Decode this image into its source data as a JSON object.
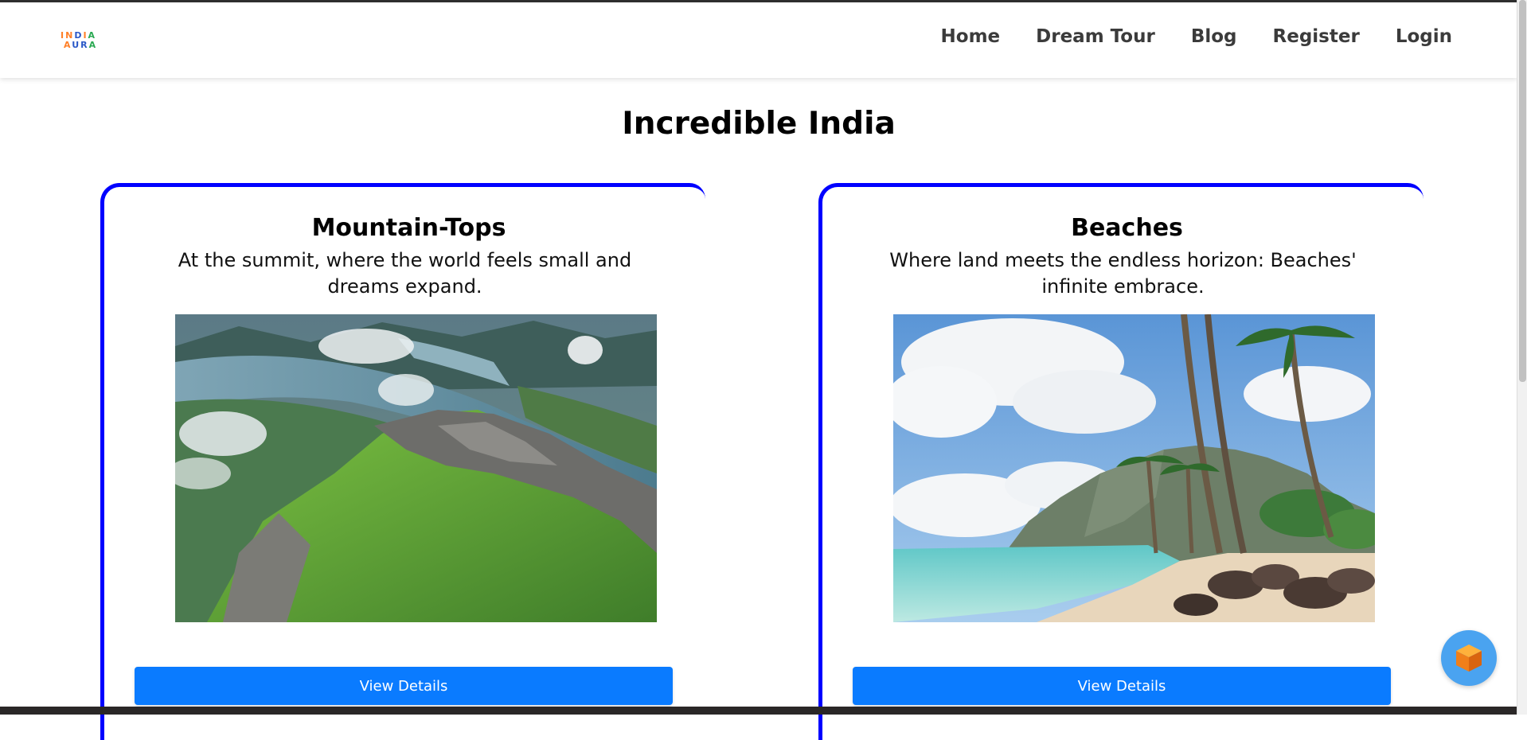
{
  "header": {
    "logo_line1": "INDIA",
    "logo_line2": "AURA",
    "nav": [
      "Home",
      "Dream Tour",
      "Blog",
      "Register",
      "Login"
    ]
  },
  "main": {
    "title": "Incredible India",
    "cards": [
      {
        "title": "Mountain-Tops",
        "description": "At the summit, where the world feels small and dreams expand.",
        "image": "mountain landscape photo",
        "button": "View Details"
      },
      {
        "title": "Beaches",
        "description": "Where land meets the endless horizon: Beaches' infinite embrace.",
        "image": "tropical beach photo",
        "button": "View Details"
      }
    ]
  },
  "colors": {
    "card_border": "#0000ff",
    "button_bg": "#0a7bff",
    "nav_text": "#3b3b3b",
    "chat_widget": "#4aa3f0"
  },
  "icons": {
    "chat_widget": "cube-icon"
  }
}
